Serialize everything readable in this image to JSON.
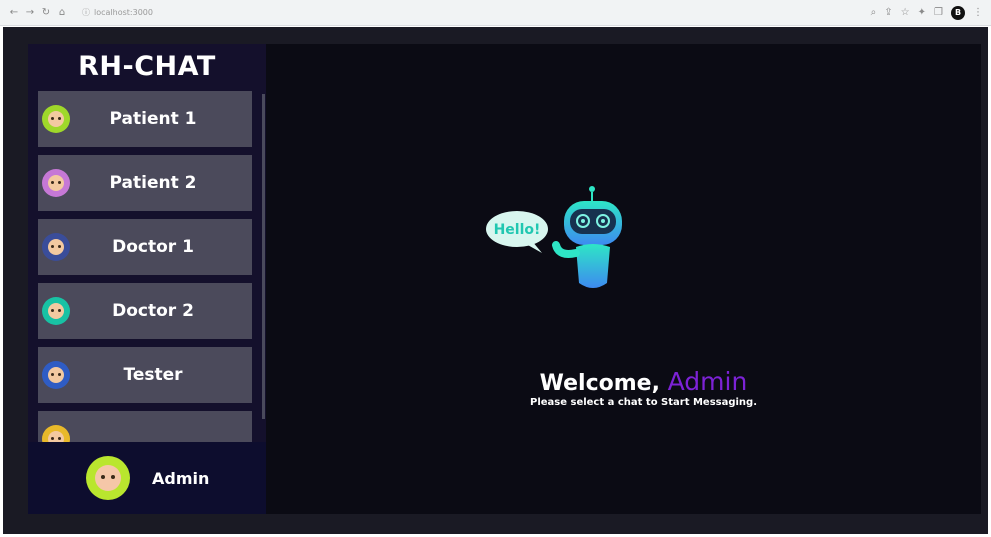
{
  "browser": {
    "url": "localhost:3000",
    "profile_initial": "B",
    "icons": [
      "back-icon",
      "forward-icon",
      "reload-icon",
      "home-icon",
      "zoom-icon",
      "share-icon",
      "star-icon",
      "pin-icon",
      "tab-icon",
      "menu-icon"
    ]
  },
  "app": {
    "brand": "RH-CHAT",
    "contacts": [
      {
        "name": "Patient 1",
        "avatar_color": "#9fd82a"
      },
      {
        "name": "Patient 2",
        "avatar_color": "#c678d6"
      },
      {
        "name": "Doctor 1",
        "avatar_color": "#3a4d9a"
      },
      {
        "name": "Doctor 2",
        "avatar_color": "#18c2a4"
      },
      {
        "name": "Tester",
        "avatar_color": "#2f5cc4"
      },
      {
        "name": "",
        "avatar_color": "#e8b92a"
      }
    ],
    "current_user": {
      "name": "Admin",
      "avatar_color": "#b9e62e"
    },
    "welcome": {
      "greeting": "Welcome,",
      "user": "Admin",
      "subtext": "Please select a chat to Start Messaging.",
      "bubble_text": "Hello!"
    },
    "colors": {
      "accent": "#7c22d6",
      "sidebar_bg": "#14102c",
      "contact_bg": "#4b4a5b",
      "main_bg": "#0b0b14",
      "bot_gradient_start": "#2ee6c6",
      "bot_gradient_end": "#3d8af0"
    }
  }
}
